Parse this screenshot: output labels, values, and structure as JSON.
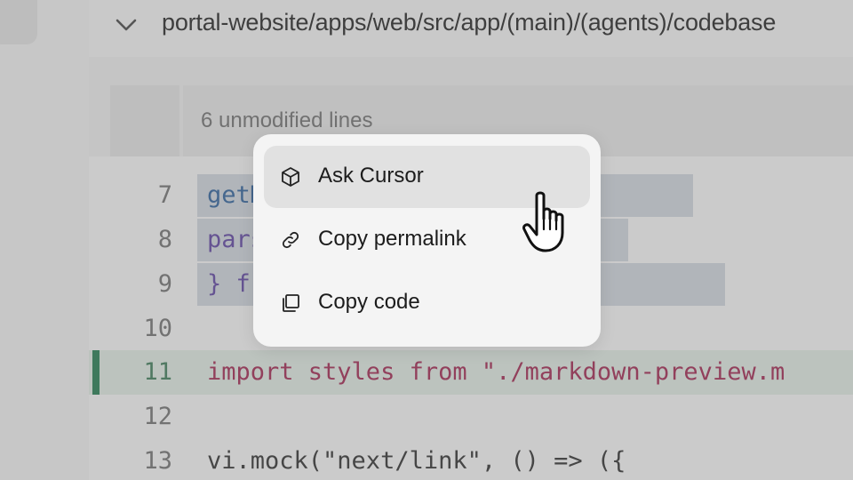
{
  "file_header": {
    "path": "portal-website/apps/web/src/app/(main)/(agents)/codebase"
  },
  "hunk": {
    "label": "6 unmodified lines"
  },
  "code_lines": [
    {
      "number": "7",
      "text": "getMarkdownLinkInfo,"
    },
    {
      "number": "8",
      "text": "parseMarkdownLink,"
    },
    {
      "number": "9",
      "text": "} from \"./markdown\";"
    },
    {
      "number": "10",
      "text": ""
    },
    {
      "number": "11",
      "text": "import styles from \"./markdown-preview.m"
    },
    {
      "number": "12",
      "text": ""
    },
    {
      "number": "13",
      "text": "vi.mock(\"next/link\", () => ({"
    }
  ],
  "context_menu": {
    "items": [
      {
        "label": "Ask Cursor",
        "icon": "cube-icon",
        "active": true
      },
      {
        "label": "Copy permalink",
        "icon": "link-icon",
        "active": false
      },
      {
        "label": "Copy code",
        "icon": "copy-icon",
        "active": false
      }
    ]
  },
  "colors": {
    "added_line_marker": "#1f7a4d",
    "keyword": "#a0224e",
    "identifier": "#2a5e9a",
    "string": "#5b3fa0"
  }
}
